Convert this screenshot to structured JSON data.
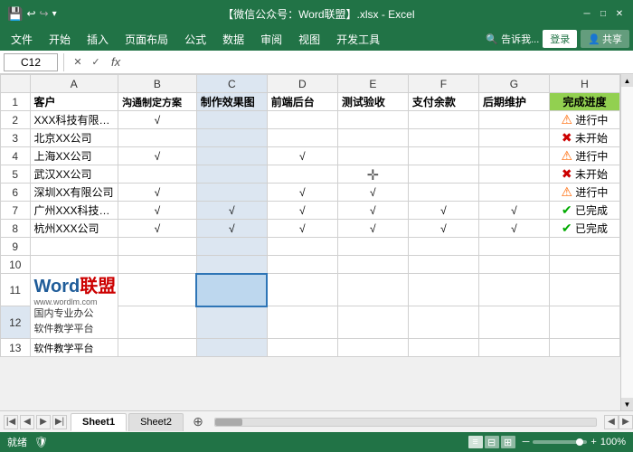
{
  "titleBar": {
    "title": "【微信公众号：Word联盟】.xlsx - Excel",
    "saveIcon": "💾",
    "undoIcon": "↩",
    "redoIcon": "↪",
    "minIcon": "─",
    "maxIcon": "□",
    "closeIcon": "✕"
  },
  "menuBar": {
    "items": [
      "文件",
      "开始",
      "插入",
      "页面布局",
      "公式",
      "数据",
      "审阅",
      "视图",
      "开发工具"
    ],
    "search": "🔍 告诉我...",
    "login": "登录",
    "share": "共享"
  },
  "formulaBar": {
    "nameBox": "C12",
    "cancelBtn": "✕",
    "confirmBtn": "✓",
    "functionBtn": "fx"
  },
  "columns": {
    "headers": [
      "A",
      "B",
      "C",
      "D",
      "E",
      "F",
      "G",
      "H"
    ],
    "widths": [
      90,
      80,
      72,
      72,
      72,
      72,
      72,
      72
    ]
  },
  "rows": [
    {
      "num": "1",
      "a": "客户",
      "b": "沟通制定方案",
      "c": "制作效果图",
      "d": "前端后台",
      "e": "测试验收",
      "f": "支付余款",
      "g": "后期维护",
      "h": "完成进度",
      "isHeader": true
    },
    {
      "num": "2",
      "a": "XXX科技有限公司",
      "b": "√",
      "c": "",
      "d": "",
      "e": "",
      "f": "",
      "g": "",
      "h": "进行中",
      "hStatus": "inprogress"
    },
    {
      "num": "3",
      "a": "北京XX公司",
      "b": "",
      "c": "",
      "d": "",
      "e": "",
      "f": "",
      "g": "",
      "h": "未开始",
      "hStatus": "notstarted"
    },
    {
      "num": "4",
      "a": "上海XX公司",
      "b": "√",
      "c": "",
      "d": "√",
      "e": "",
      "f": "",
      "g": "",
      "h": "进行中",
      "hStatus": "inprogress"
    },
    {
      "num": "5",
      "a": "武汉XX公司",
      "b": "",
      "c": "",
      "d": "",
      "e": "",
      "f": "",
      "g": "",
      "h": "未开始",
      "hStatus": "notstarted",
      "cursorInE": true
    },
    {
      "num": "6",
      "a": "深圳XX有限公司",
      "b": "√",
      "c": "",
      "d": "√",
      "e": "√",
      "f": "",
      "g": "",
      "h": "进行中",
      "hStatus": "inprogress"
    },
    {
      "num": "7",
      "a": "广州XXX科技公司",
      "b": "√",
      "c": "√",
      "d": "√",
      "e": "√",
      "f": "√",
      "g": "√",
      "h": "已完成",
      "hStatus": "done"
    },
    {
      "num": "8",
      "a": "杭州XXX公司",
      "b": "√",
      "c": "√",
      "d": "√",
      "e": "√",
      "f": "√",
      "g": "√",
      "h": "已完成",
      "hStatus": "done"
    },
    {
      "num": "9",
      "a": "",
      "b": "",
      "c": "",
      "d": "",
      "e": "",
      "f": "",
      "g": "",
      "h": ""
    },
    {
      "num": "10",
      "a": "",
      "b": "",
      "c": "",
      "d": "",
      "e": "",
      "f": "",
      "g": "",
      "h": ""
    },
    {
      "num": "11",
      "a": "watermark",
      "b": "",
      "c": "",
      "d": "",
      "e": "",
      "f": "",
      "g": "",
      "h": ""
    },
    {
      "num": "12",
      "a": "国内专业办公",
      "b": "",
      "c": "",
      "d": "",
      "e": "",
      "f": "",
      "g": "",
      "h": ""
    },
    {
      "num": "13",
      "a": "软件教学平台",
      "b": "",
      "c": "",
      "d": "",
      "e": "",
      "f": "",
      "g": "",
      "h": ""
    }
  ],
  "watermark": {
    "logoWord": "Word",
    "logoSuffix": "联盟",
    "url": "www.wordlm.com",
    "line1": "国内专业办公",
    "line2": "软件教学平台"
  },
  "sheets": {
    "tabs": [
      "Sheet1",
      "Sheet2"
    ],
    "active": "Sheet1"
  },
  "statusBar": {
    "status": "就绪",
    "zoom": "100%"
  }
}
